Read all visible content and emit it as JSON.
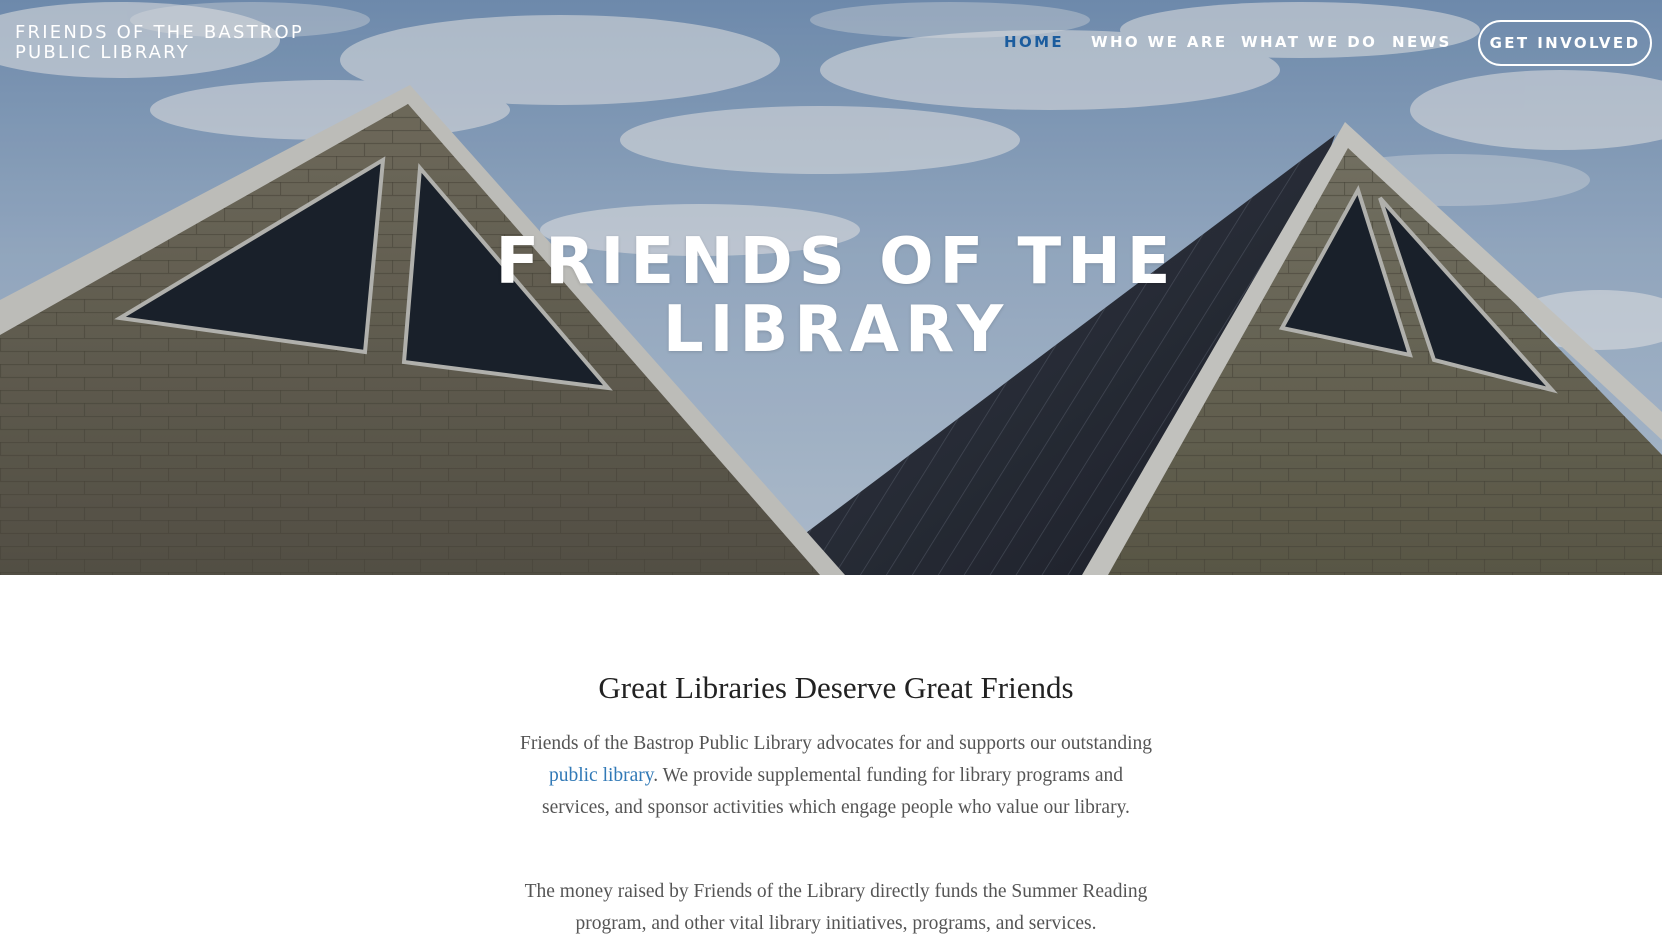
{
  "header": {
    "site_title": "FRIENDS OF THE BASTROP PUBLIC LIBRARY",
    "nav": [
      {
        "label": "HOME",
        "active": true
      },
      {
        "label": "WHO WE ARE",
        "active": false
      },
      {
        "label": "WHAT WE DO",
        "active": false
      },
      {
        "label": "NEWS",
        "active": false
      }
    ],
    "cta_label": "GET INVOLVED"
  },
  "hero": {
    "heading_line_1": "FRIENDS OF THE",
    "heading_line_2": "LIBRARY"
  },
  "main": {
    "heading": "Great Libraries Deserve Great Friends",
    "paragraph_1": {
      "before_link": "Friends of the Bastrop Public Library advocates for and supports our outstanding ",
      "link_text": "public library",
      "after_link": ". We provide supplemental funding for library programs and services, and sponsor activities which engage people who value our library."
    },
    "paragraph_2": "The money raised by Friends of the Library directly funds the Summer Reading program, and other vital library initiatives, programs, and services."
  },
  "colors": {
    "nav_active": "#1b5c9e",
    "link": "#3179b6",
    "body_text": "#555555",
    "heading_text": "#222222"
  }
}
